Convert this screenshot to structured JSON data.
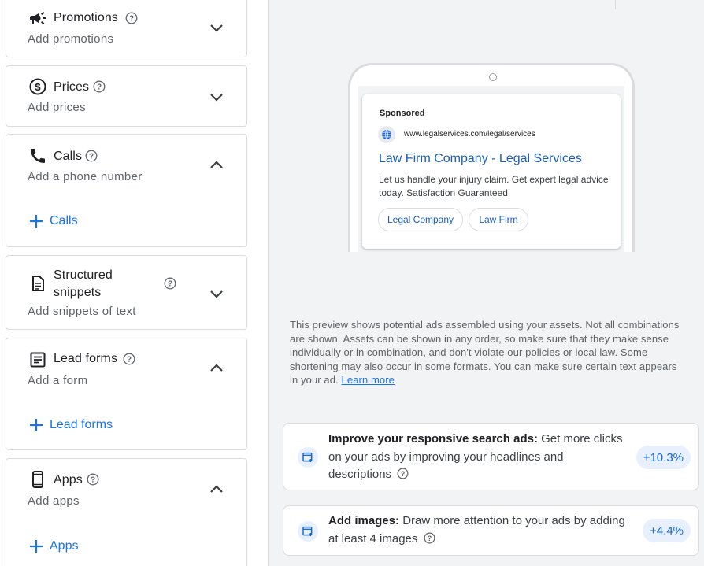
{
  "left_panel": {
    "promotions": {
      "title": "Promotions",
      "subtitle": "Add promotions"
    },
    "prices": {
      "title": "Prices",
      "subtitle": "Add prices"
    },
    "calls": {
      "title": "Calls",
      "subtitle": "Add a phone number",
      "add_label": "Calls"
    },
    "snippets": {
      "title_line1": "Structured",
      "title_line2": "snippets",
      "subtitle": "Add snippets of text"
    },
    "lead_forms": {
      "title": "Lead forms",
      "subtitle": "Add a form",
      "add_label": "Lead forms"
    },
    "apps": {
      "title": "Apps",
      "subtitle": "Add apps",
      "add_label": "Apps"
    }
  },
  "ad_preview": {
    "sponsored": "Sponsored",
    "url": "www.legalservices.com/legal/services",
    "headline": "Law Firm Company - Legal Services",
    "description": "Let us handle your injury claim. Get expert legal advice today. Satisfaction Guaranteed.",
    "chips": [
      "Legal Company",
      "Law Firm"
    ]
  },
  "preview_note": {
    "text": "This preview shows potential ads assembled using your assets. Not all combinations are shown. Assets can be shown in any order, so make sure that they make sense individually or in combination, and don't violate our policies or local law. Some shortening may also occur in some formats. You can make sure certain text appears in your ad.",
    "link": "Learn more"
  },
  "recommendations": [
    {
      "title": "Improve your responsive search ads:",
      "body": "Get more clicks on your ads by improving your headlines and descriptions",
      "badge": "+10.3%"
    },
    {
      "title": "Add images:",
      "body": "Draw more attention to your ads by adding at least 4 images",
      "badge": "+4.4%"
    }
  ],
  "colors": {
    "accent": "#1a73e8",
    "border": "#dadce0",
    "muted": "#5f6368",
    "panel_bg": "#f1f3f4"
  }
}
